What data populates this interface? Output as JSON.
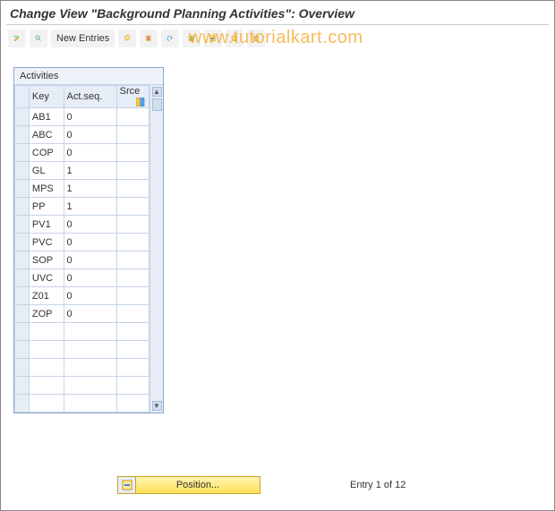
{
  "title": "Change View \"Background Planning Activities\": Overview",
  "toolbar": {
    "new_entries_label": "New Entries"
  },
  "watermark": "www.tutorialkart.com",
  "panel_title": "Activities",
  "columns": {
    "key": "Key",
    "actseq": "Act.seq.",
    "srce": "Srce"
  },
  "rows": [
    {
      "key": "AB1",
      "seq": "0",
      "srce": ""
    },
    {
      "key": "ABC",
      "seq": "0",
      "srce": ""
    },
    {
      "key": "COP",
      "seq": "0",
      "srce": ""
    },
    {
      "key": "GL",
      "seq": "1",
      "srce": ""
    },
    {
      "key": "MPS",
      "seq": "1",
      "srce": ""
    },
    {
      "key": "PP",
      "seq": "1",
      "srce": ""
    },
    {
      "key": "PV1",
      "seq": "0",
      "srce": ""
    },
    {
      "key": "PVC",
      "seq": "0",
      "srce": ""
    },
    {
      "key": "SOP",
      "seq": "0",
      "srce": ""
    },
    {
      "key": "UVC",
      "seq": "0",
      "srce": ""
    },
    {
      "key": "Z01",
      "seq": "0",
      "srce": ""
    },
    {
      "key": "ZOP",
      "seq": "0",
      "srce": ""
    },
    {
      "key": "",
      "seq": "",
      "srce": ""
    },
    {
      "key": "",
      "seq": "",
      "srce": ""
    },
    {
      "key": "",
      "seq": "",
      "srce": ""
    },
    {
      "key": "",
      "seq": "",
      "srce": ""
    },
    {
      "key": "",
      "seq": "",
      "srce": ""
    }
  ],
  "footer": {
    "position_label": "Position...",
    "entry_text": "Entry 1 of 12"
  }
}
